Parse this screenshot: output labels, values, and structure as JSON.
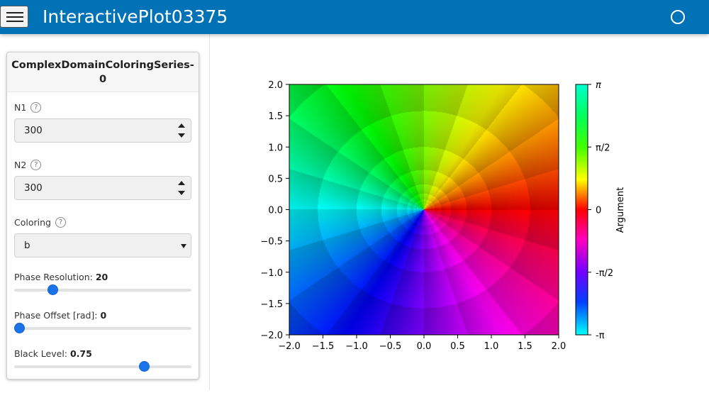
{
  "app": {
    "title": "InteractivePlot03375"
  },
  "panel": {
    "header": "ComplexDomainColoringSeries-0",
    "n1": {
      "label": "N1",
      "value": "300"
    },
    "n2": {
      "label": "N2",
      "value": "300"
    },
    "coloring": {
      "label": "Coloring",
      "value": "b"
    },
    "phase_resolution": {
      "label": "Phase Resolution:",
      "value": "20",
      "fraction": 0.2
    },
    "phase_offset": {
      "label": "Phase Offset [rad]:",
      "value": "0",
      "fraction": 0.0
    },
    "black_level": {
      "label": "Black Level:",
      "value": "0.75",
      "fraction": 0.75
    }
  },
  "chart_data": {
    "type": "heatmap",
    "description_kind": "complex domain coloring (argument as hue)",
    "xlim": [
      -2.0,
      2.0
    ],
    "ylim": [
      -2.0,
      2.0
    ],
    "x_ticks": [
      "−2.0",
      "−1.5",
      "−1.0",
      "−0.5",
      "0.0",
      "0.5",
      "1.0",
      "1.5",
      "2.0"
    ],
    "y_ticks": [
      "2.0",
      "1.5",
      "1.0",
      "0.5",
      "0.0",
      "−0.5",
      "−1.0",
      "−1.5",
      "−2.0"
    ],
    "colorbar": {
      "label": "Argument",
      "ticks": [
        "π",
        "π/2",
        "0",
        "-π/2",
        "-π"
      ],
      "colors_top_to_bottom": [
        "#00ffd0",
        "#22dd00",
        "#ffff00",
        "#ff0000",
        "#ff00ff",
        "#0000ff",
        "#00ffff"
      ]
    }
  }
}
